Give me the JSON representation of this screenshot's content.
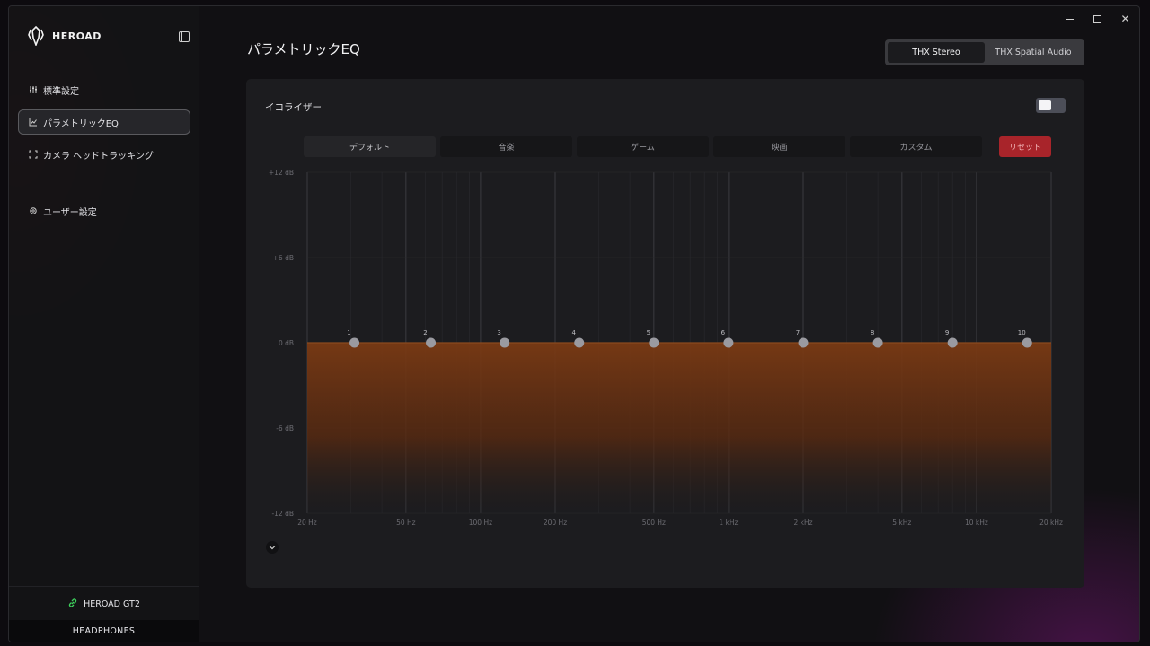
{
  "window": {
    "controls": {
      "minimize": "",
      "maximize": "",
      "close": "✕"
    }
  },
  "sidebar": {
    "logo_text": "HEROAD",
    "items": [
      {
        "label": "標準設定",
        "icon": "sliders-icon"
      },
      {
        "label": "パラメトリックEQ",
        "icon": "line-chart-icon",
        "active": true
      },
      {
        "label": "カメラ ヘッドトラッキング",
        "icon": "focus-frame-icon"
      }
    ],
    "user_settings": {
      "label": "ユーザー設定",
      "icon": "gear-icon"
    },
    "device": {
      "name": "HEROAD GT2",
      "type": "HEADPHONES",
      "status_color": "#3ecf5c"
    }
  },
  "header": {
    "title": "パラメトリックEQ",
    "modes": [
      {
        "label": "THX Stereo",
        "active": true
      },
      {
        "label": "THX Spatial Audio",
        "active": false
      }
    ]
  },
  "equalizer": {
    "label": "イコライザー",
    "enabled": true,
    "presets": [
      {
        "label": "デフォルト",
        "active": true
      },
      {
        "label": "音楽",
        "active": false
      },
      {
        "label": "ゲーム",
        "active": false
      },
      {
        "label": "映画",
        "active": false
      },
      {
        "label": "カスタム",
        "active": false
      }
    ],
    "reset_label": "リセット"
  },
  "chart_data": {
    "type": "area",
    "x_scale": "log",
    "xlim": [
      20,
      20000
    ],
    "ylim": [
      -12,
      12
    ],
    "y_ticks": [
      12,
      6,
      0,
      -6,
      -12
    ],
    "y_tick_labels": [
      "+12 dB",
      "+6 dB",
      "0 dB",
      "-6 dB",
      "-12 dB"
    ],
    "x_ticks": [
      20,
      50,
      100,
      200,
      500,
      1000,
      2000,
      5000,
      10000,
      20000
    ],
    "x_tick_labels": [
      "20 Hz",
      "50 Hz",
      "100 Hz",
      "200 Hz",
      "500 Hz",
      "1 kHz",
      "2 kHz",
      "5 kHz",
      "10 kHz",
      "20 kHz"
    ],
    "grid": true,
    "fill_color": "#7a3a14",
    "bands": [
      {
        "label": "1",
        "freq": 31,
        "gain": 0
      },
      {
        "label": "2",
        "freq": 63,
        "gain": 0
      },
      {
        "label": "3",
        "freq": 125,
        "gain": 0
      },
      {
        "label": "4",
        "freq": 250,
        "gain": 0
      },
      {
        "label": "5",
        "freq": 500,
        "gain": 0
      },
      {
        "label": "6",
        "freq": 1000,
        "gain": 0
      },
      {
        "label": "7",
        "freq": 2000,
        "gain": 0
      },
      {
        "label": "8",
        "freq": 4000,
        "gain": 0
      },
      {
        "label": "9",
        "freq": 8000,
        "gain": 0
      },
      {
        "label": "10",
        "freq": 16000,
        "gain": 0
      }
    ]
  }
}
